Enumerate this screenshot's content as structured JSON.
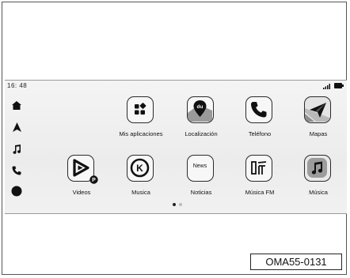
{
  "status": {
    "time": "16: 48"
  },
  "dock": {
    "items": [
      {
        "icon": "home-icon"
      },
      {
        "icon": "navigation-icon"
      },
      {
        "icon": "music-note-icon"
      },
      {
        "icon": "phone-icon"
      },
      {
        "icon": "record-icon"
      }
    ]
  },
  "apps": [
    {
      "label": "Mis aplicaciones",
      "icon": "app-grid-icon"
    },
    {
      "label": "Localización",
      "icon": "location-du-icon"
    },
    {
      "label": "Teléfono",
      "icon": "phone-icon"
    },
    {
      "label": "Mapas",
      "icon": "paper-plane-map-icon"
    },
    {
      "label": "Videos",
      "icon": "video-play-icon"
    },
    {
      "label": "Musica",
      "icon": "k-music-icon"
    },
    {
      "label": "Noticias",
      "icon": "news-icon",
      "tile_text": "News"
    },
    {
      "label": "Música FM",
      "icon": "fm-radio-icon"
    },
    {
      "label": "Música",
      "icon": "music-note-icon"
    }
  ],
  "pager": {
    "active_index": 0,
    "count": 2
  },
  "reference_code": "OMA55-0131"
}
